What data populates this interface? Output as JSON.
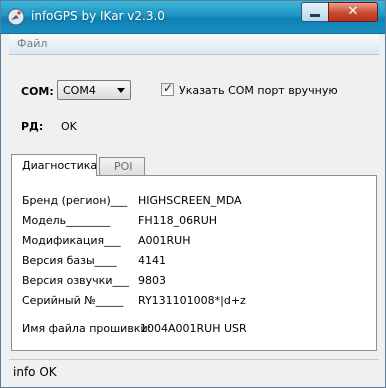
{
  "window": {
    "title": "infoGPS  by IKar v2.3.0",
    "close_glyph": "✕"
  },
  "menu": {
    "file": "Файл"
  },
  "com": {
    "label": "COM:",
    "selected": "COM4",
    "manual_checked": true,
    "manual_label": "Указать COM  порт вручную"
  },
  "rd": {
    "label": "РД:",
    "value": "OK"
  },
  "tabs": [
    {
      "label": "Диагностика",
      "active": true
    },
    {
      "label": "POI",
      "active": false
    }
  ],
  "diagnostics": {
    "rows": [
      {
        "label": "Бренд (регион)___",
        "value": "HIGHSCREEN_MDA"
      },
      {
        "label": "Модель________",
        "value": "FH118_06RUH"
      },
      {
        "label": "Модификация___",
        "value": "A001RUH"
      },
      {
        "label": "Версия базы____",
        "value": "4141"
      },
      {
        "label": "Версия озвучки___",
        "value": "9803"
      },
      {
        "label": "Серийный №_____",
        "value": "RY131101008*|d+z"
      }
    ],
    "firmware_label": "Имя файла прошивки:",
    "firmware_value": "1004A001RUH  USR"
  },
  "status": {
    "text": "info OK"
  },
  "colors": {
    "titlebar": "#1f96c4",
    "close_button": "#c74a31"
  },
  "icons": {
    "app": "satellite-dish-icon",
    "minimize": "minimize-icon",
    "close": "close-icon",
    "dropdown": "chevron-down-icon",
    "check": "checkmark-icon"
  }
}
